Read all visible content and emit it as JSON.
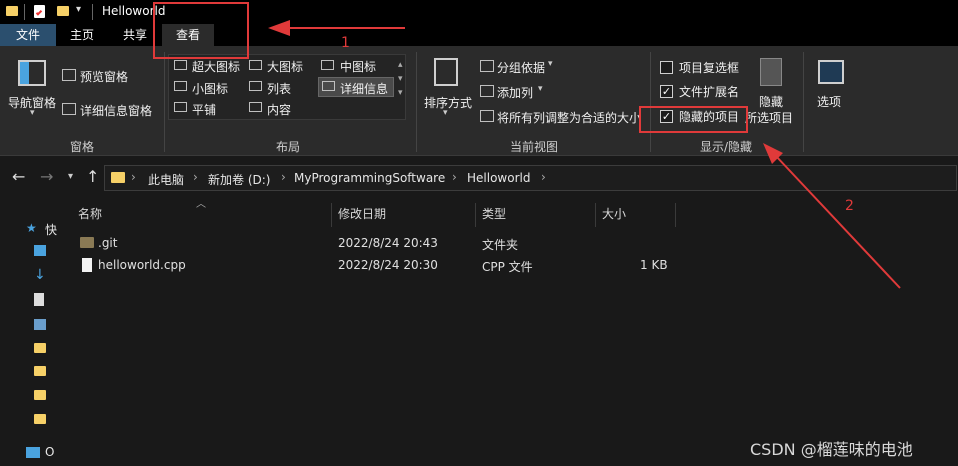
{
  "titlebar": {
    "title": "Helloworld"
  },
  "tabs": [
    "文件",
    "主页",
    "共享",
    "查看"
  ],
  "ribbon": {
    "pane_group": {
      "nav_pane": "导航窗格",
      "preview_pane": "预览窗格",
      "details_pane": "详细信息窗格",
      "label": "窗格"
    },
    "layout_group": {
      "items": [
        "超大图标",
        "大图标",
        "中图标",
        "小图标",
        "列表",
        "详细信息",
        "平铺",
        "内容"
      ],
      "label": "布局"
    },
    "current_view_group": {
      "sort_by": "排序方式",
      "group_by": "分组依据",
      "add_columns": "添加列",
      "size_all_columns": "将所有列调整为合适的大小",
      "label": "当前视图"
    },
    "show_hide_group": {
      "item_checkboxes": {
        "label": "项目复选框",
        "checked": false
      },
      "file_name_extensions": {
        "label": "文件扩展名",
        "checked": true
      },
      "hidden_items": {
        "label": "隐藏的项目",
        "checked": true
      },
      "hide_selected_line1": "隐藏",
      "hide_selected_line2": "所选项目",
      "label": "显示/隐藏"
    },
    "options": "选项"
  },
  "address": {
    "crumbs": [
      "此电脑",
      "新加卷 (D:)",
      "MyProgrammingSoftware",
      "Helloworld"
    ]
  },
  "leftpane": {
    "quick_access": "快",
    "bottom_item": "O"
  },
  "filelist": {
    "columns": [
      "名称",
      "修改日期",
      "类型",
      "大小"
    ],
    "rows": [
      {
        "name": ".git",
        "date": "2022/8/24 20:43",
        "type": "文件夹",
        "size": ""
      },
      {
        "name": "helloworld.cpp",
        "date": "2022/8/24 20:30",
        "type": "CPP 文件",
        "size": "1 KB"
      }
    ]
  },
  "annotations": {
    "num1": "1",
    "num2": "2",
    "color": "#e03a3a"
  },
  "watermark": "CSDN @榴莲味的电池"
}
